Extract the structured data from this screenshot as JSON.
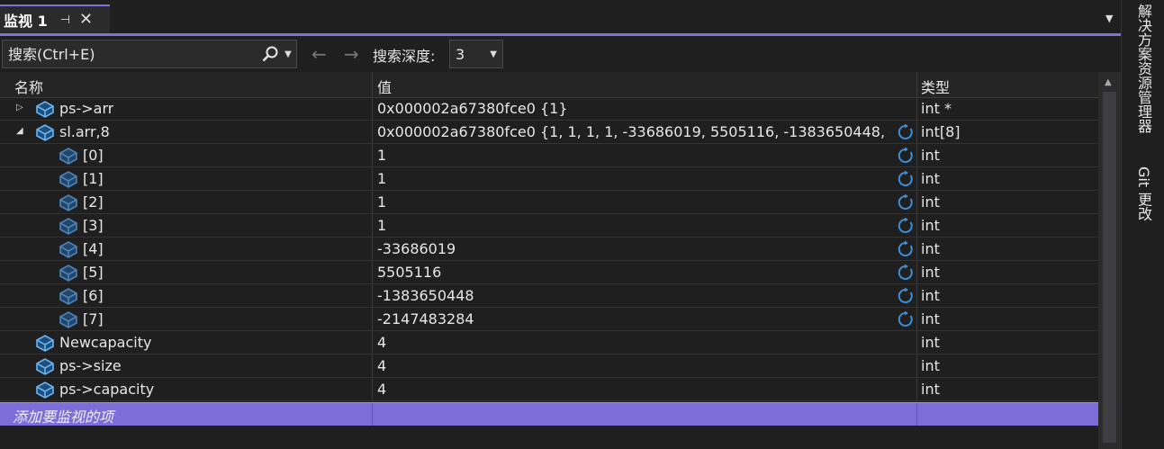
{
  "tab": {
    "title": "监视 1",
    "pin_glyph": "⊣",
    "close_glyph": "✕"
  },
  "toolbar": {
    "search_placeholder": "搜索(Ctrl+E)",
    "back_glyph": "←",
    "forward_glyph": "→",
    "depth_label": "搜索深度:",
    "depth_value": "3"
  },
  "columns": {
    "name": "名称",
    "value": "值",
    "type": "类型"
  },
  "rows": [
    {
      "name": "ps->arr",
      "value": "0x000002a67380fce0 {1}",
      "type": "int *",
      "expander": "▷",
      "refresh": false
    },
    {
      "name": "sl.arr,8",
      "value": "0x000002a67380fce0 {1, 1, 1, 1, -33686019, 5505116, -1383650448, -...",
      "type": "int[8]",
      "expander": "◢",
      "refresh": true
    },
    {
      "name": "[0]",
      "value": "1",
      "type": "int",
      "refresh": true
    },
    {
      "name": "[1]",
      "value": "1",
      "type": "int",
      "refresh": true
    },
    {
      "name": "[2]",
      "value": "1",
      "type": "int",
      "refresh": true
    },
    {
      "name": "[3]",
      "value": "1",
      "type": "int",
      "refresh": true
    },
    {
      "name": "[4]",
      "value": "-33686019",
      "type": "int",
      "refresh": true
    },
    {
      "name": "[5]",
      "value": "5505116",
      "type": "int",
      "refresh": true
    },
    {
      "name": "[6]",
      "value": "-1383650448",
      "type": "int",
      "refresh": true
    },
    {
      "name": "[7]",
      "value": "-2147483284",
      "type": "int",
      "refresh": true
    },
    {
      "name": "Newcapacity",
      "value": "4",
      "type": "int",
      "refresh": false
    },
    {
      "name": "ps->size",
      "value": "4",
      "type": "int",
      "refresh": false
    },
    {
      "name": "ps->capacity",
      "value": "4",
      "type": "int",
      "refresh": false
    }
  ],
  "add_watch_label": "添加要监视的项",
  "side_tabs": [
    "解决方案资源管理器",
    "Git 更改"
  ],
  "colors": {
    "accent": "#7b73d9",
    "add_row": "#7b6ed8",
    "icon_blue": "#3b8ed8"
  }
}
